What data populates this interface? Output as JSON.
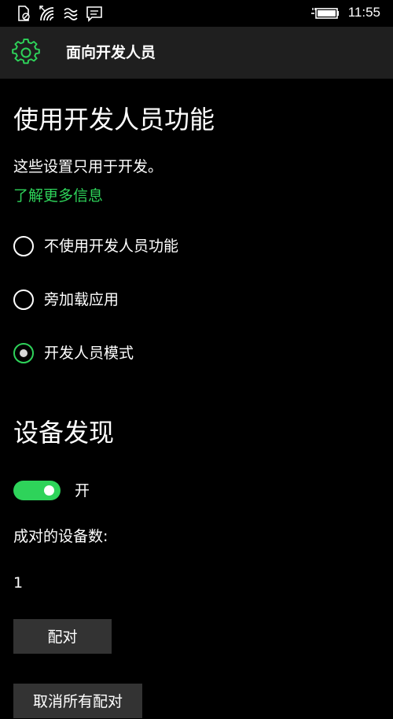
{
  "status_bar": {
    "icons": [
      "no-sim-icon",
      "wifi-icon",
      "signal-waves-icon",
      "message-icon",
      "battery-charging-icon"
    ],
    "time": "11:55"
  },
  "header": {
    "icon": "gear-icon",
    "title": "面向开发人员"
  },
  "developer_features": {
    "title": "使用开发人员功能",
    "description": "这些设置只用于开发。",
    "learn_more_link": "了解更多信息",
    "options": [
      {
        "label": "不使用开发人员功能",
        "selected": false
      },
      {
        "label": "旁加载应用",
        "selected": false
      },
      {
        "label": "开发人员模式",
        "selected": true
      }
    ]
  },
  "device_discovery": {
    "title": "设备发现",
    "toggle_state": "开",
    "toggle_on": true,
    "paired_count_label": "成对的设备数:",
    "paired_count": "1",
    "pair_button": "配对",
    "unpair_all_button": "取消所有配对"
  },
  "colors": {
    "accent": "#2ed35a",
    "header_bg": "#1f1f1f",
    "button_bg": "#333333",
    "background": "#000000"
  }
}
